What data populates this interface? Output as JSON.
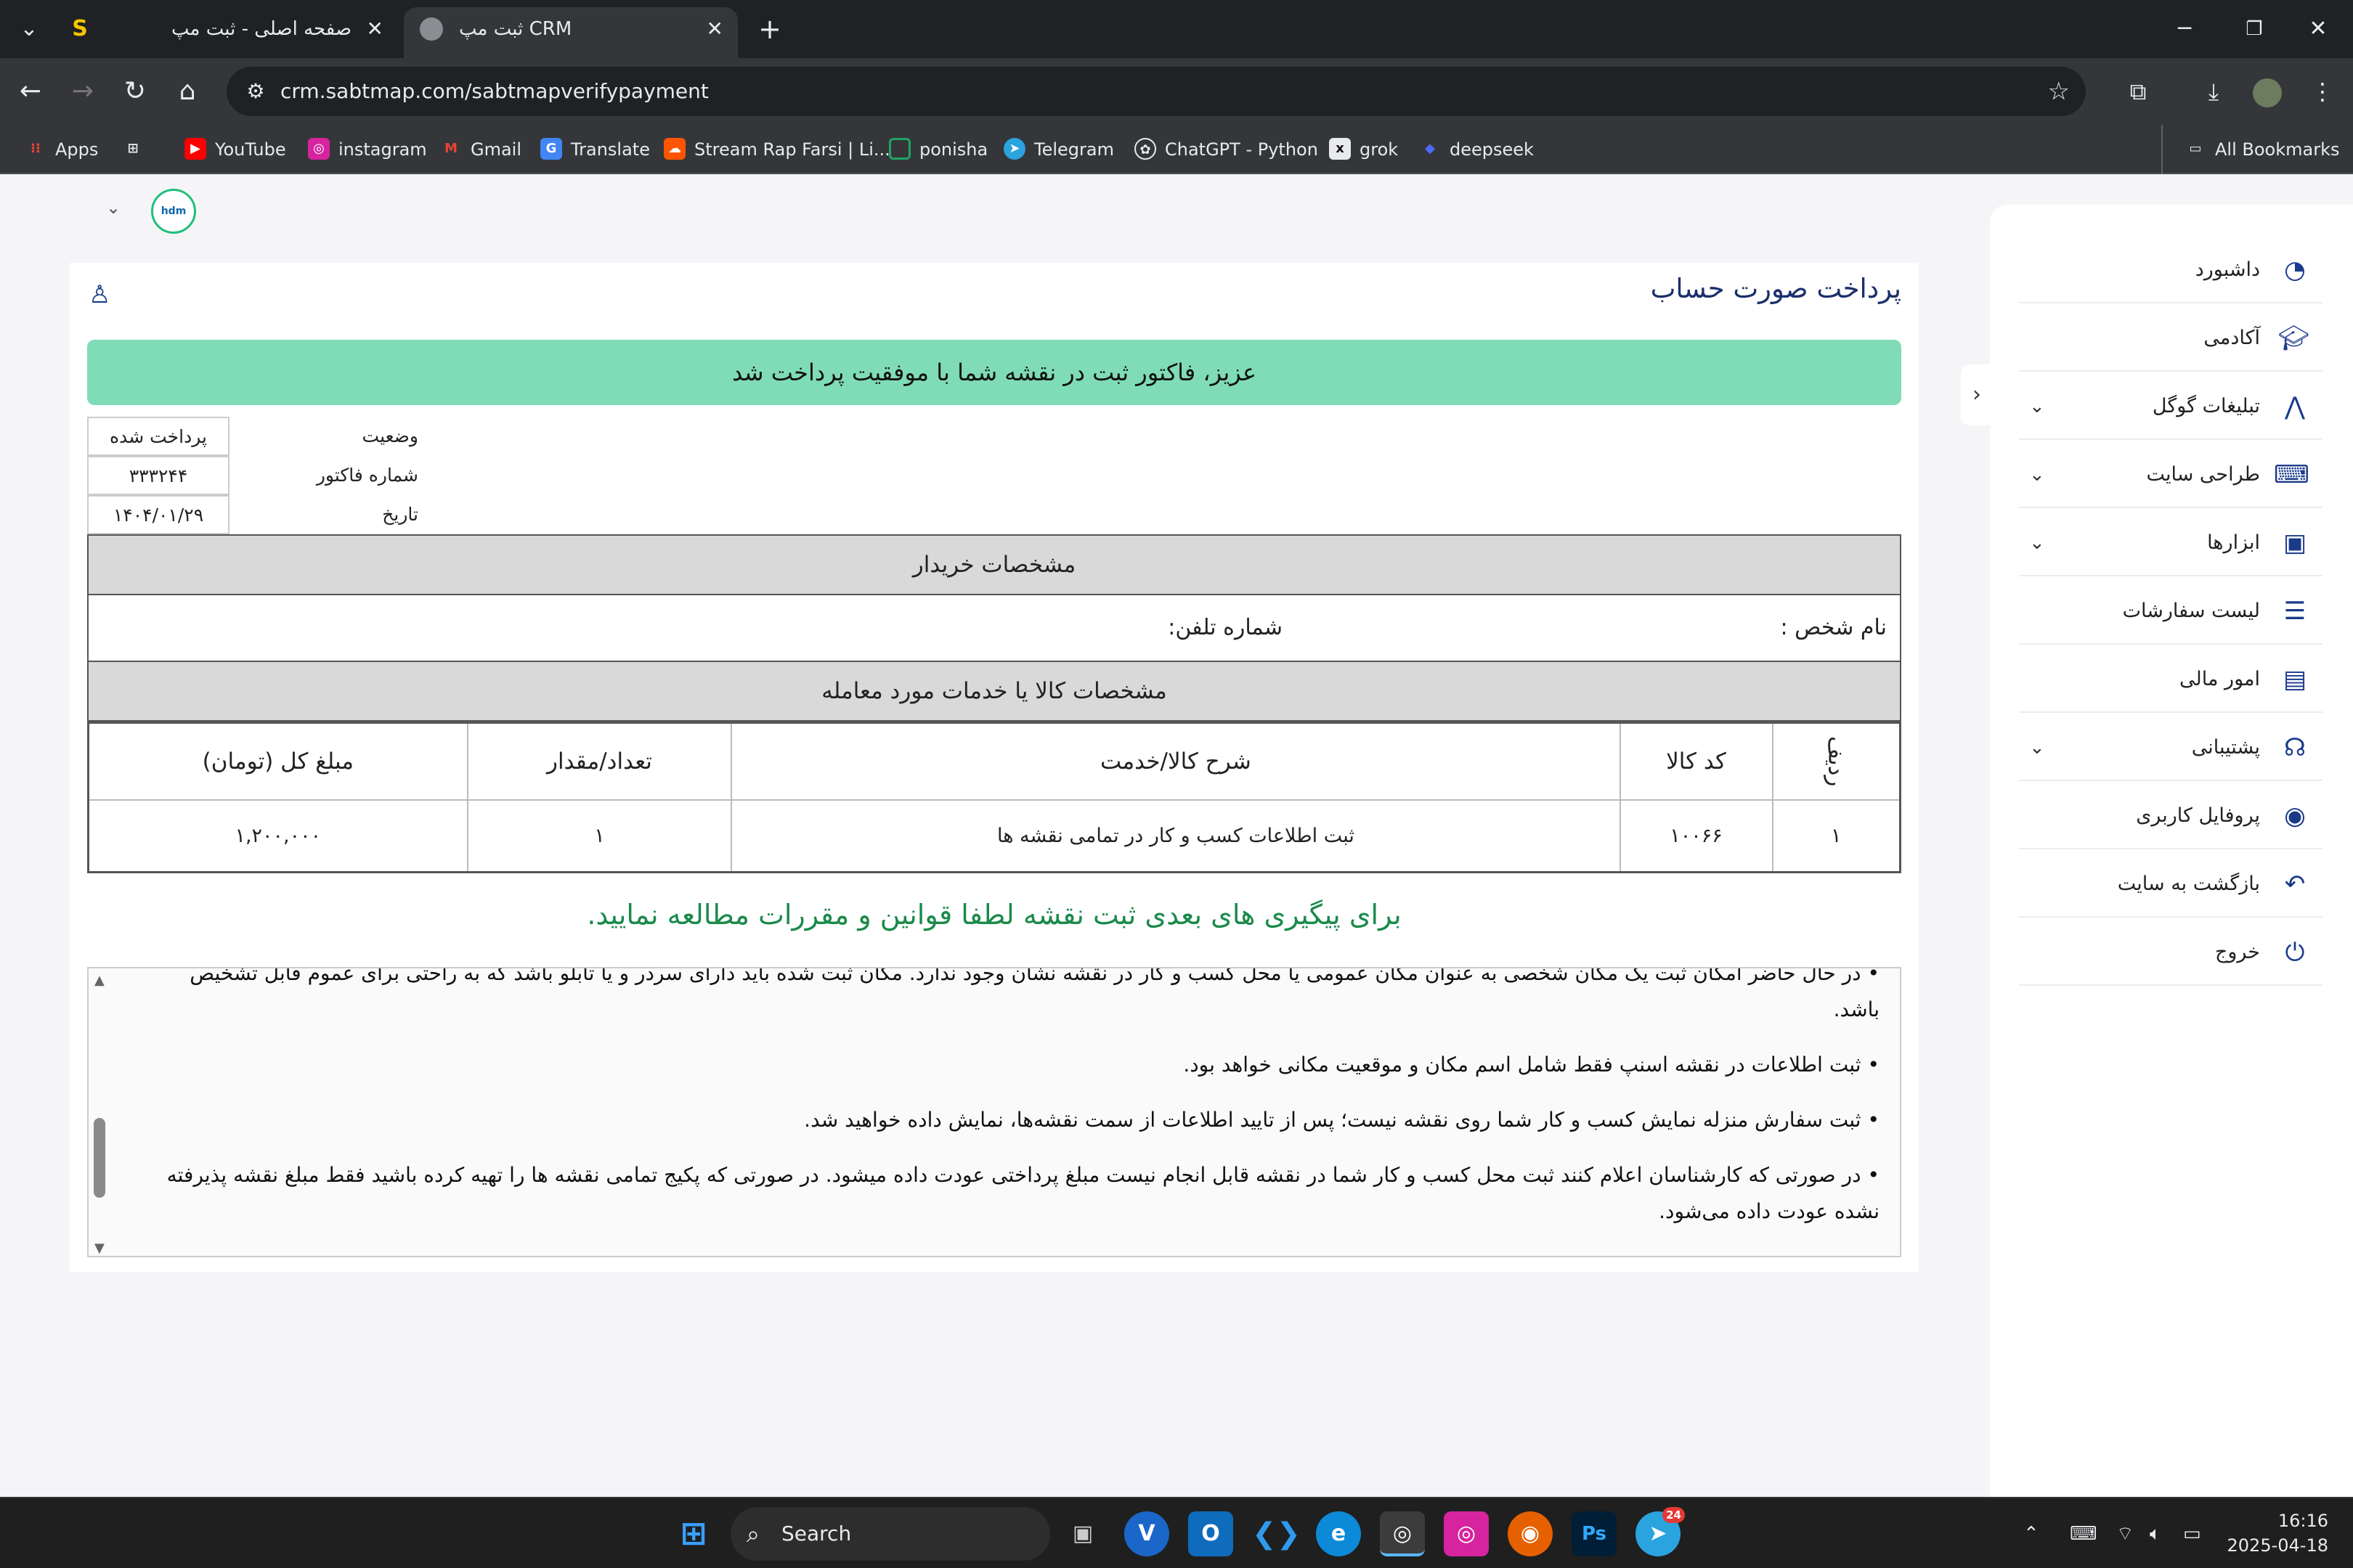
{
  "browser": {
    "tabs": [
      {
        "title": "صفحه اصلی - ثبت مپ",
        "active": false
      },
      {
        "title": "ثبت مپ CRM",
        "active": true
      }
    ],
    "new_tab_symbol": "+",
    "url": "crm.sabtmap.com/sabtmapverifypayment",
    "bookmarks": [
      {
        "label": "Apps",
        "icon": "apps-grid-icon",
        "color": "#ea4335"
      },
      {
        "label": "YouTube",
        "icon": "youtube-icon",
        "color": "#ff0000"
      },
      {
        "label": "instagram",
        "icon": "instagram-icon",
        "color": "#d6249f"
      },
      {
        "label": "Gmail",
        "icon": "gmail-icon",
        "color": "#ea4335"
      },
      {
        "label": "Translate",
        "icon": "translate-icon",
        "color": "#4285f4"
      },
      {
        "label": "Stream Rap Farsi | Li...",
        "icon": "soundcloud-icon",
        "color": "#ff5500"
      },
      {
        "label": "ponisha",
        "icon": "ponisha-icon",
        "color": "#1fa463"
      },
      {
        "label": "Telegram",
        "icon": "telegram-icon",
        "color": "#2aa3df"
      },
      {
        "label": "ChatGPT - Python",
        "icon": "chatgpt-icon",
        "color": "#e8eaed"
      },
      {
        "label": "grok",
        "icon": "grok-icon",
        "color": "#e8eaed"
      },
      {
        "label": "deepseek",
        "icon": "deepseek-icon",
        "color": "#4d6bfe"
      }
    ],
    "all_bookmarks": "All Bookmarks"
  },
  "sidebar": {
    "items": [
      {
        "label": "داشبورد",
        "icon": "dashboard-gauge-icon",
        "expandable": false
      },
      {
        "label": "آکادمی",
        "icon": "graduation-cap-icon",
        "expandable": false
      },
      {
        "label": "تبلیغات گوگل",
        "icon": "google-ads-icon",
        "expandable": true
      },
      {
        "label": "طراحی سایت",
        "icon": "laptop-code-icon",
        "expandable": true
      },
      {
        "label": "ابزارها",
        "icon": "toolbox-icon",
        "expandable": true
      },
      {
        "label": "لیست سفارشات",
        "icon": "list-icon",
        "expandable": false
      },
      {
        "label": "امور مالی",
        "icon": "money-bill-icon",
        "expandable": false
      },
      {
        "label": "پشتیبانی",
        "icon": "headset-icon",
        "expandable": true
      },
      {
        "label": "پروفایل کاربری",
        "icon": "fingerprint-icon",
        "expandable": false
      },
      {
        "label": "بازگشت به سایت",
        "icon": "return-arrow-icon",
        "expandable": false
      },
      {
        "label": "خروج",
        "icon": "logout-icon",
        "expandable": false
      }
    ]
  },
  "page": {
    "title": "پرداخت صورت حساب",
    "success_message": "عزیز، فاکتور ثبت در نقشه شما با موفقیت پرداخت شد",
    "invoice": {
      "status_label": "وضعیت",
      "status_value": "پرداخت شده",
      "number_label": "شماره فاکتور",
      "number_value": "۳۳۳۲۴۴",
      "date_label": "تاریخ",
      "date_value": "۱۴۰۴/۰۱/۲۹"
    },
    "buyer": {
      "heading": "مشخصات خریدار",
      "name_label": "نام شخص :",
      "phone_label": "شماره تلفن:"
    },
    "items": {
      "heading": "مشخصات کالا یا خدمات مورد معامله",
      "columns": [
        "ردیف",
        "کد کالا",
        "شرح کالا/خدمت",
        "تعداد/مقدار",
        "مبلغ کل (تومان)"
      ],
      "rows": [
        [
          "۱",
          "۱۰۰۶۶",
          "ثبت اطلاعات کسب و کار در تمامی نقشه ها",
          "۱",
          "۱,۲۰۰,۰۰۰"
        ]
      ]
    },
    "follow_note": "برای پیگیری های بعدی ثبت نقشه لطفا قوانین و مقررات مطالعه نمایید.",
    "terms": [
      "• در حال حاضر امکان ثبت یک مکان شخصی به عنوان مکان عمومی یا محل کسب و کار در نقشه نشان وجود ندارد. مکان ثبت شده باید دارای سردر و یا تابلو باشد که به راحتی برای عموم قابل تشخیص باشد.",
      "• ثبت اطلاعات در نقشه اسنپ فقط شامل اسم مکان و موقعیت مکانی خواهد بود.",
      "• ثبت سفارش منزله نمایش کسب و کار شما روی نقشه نیست؛ پس از تایید اطلاعات از سمت نقشه‌ها، نمایش داده خواهید شد.",
      "• در صورتی که کارشناسان اعلام کنند ثبت محل کسب و کار شما در نقشه قابل انجام نیست مبلغ پرداختی عودت داده میشود. در صورتی که پکیج تمامی نقشه ها را تهیه کرده باشید فقط مبلغ نقشه پذیرفته نشده عودت داده می‌شود."
    ]
  },
  "taskbar": {
    "search_placeholder": "Search",
    "time": "16:16",
    "date": "2025-04-18",
    "telegram_badge": "24"
  }
}
